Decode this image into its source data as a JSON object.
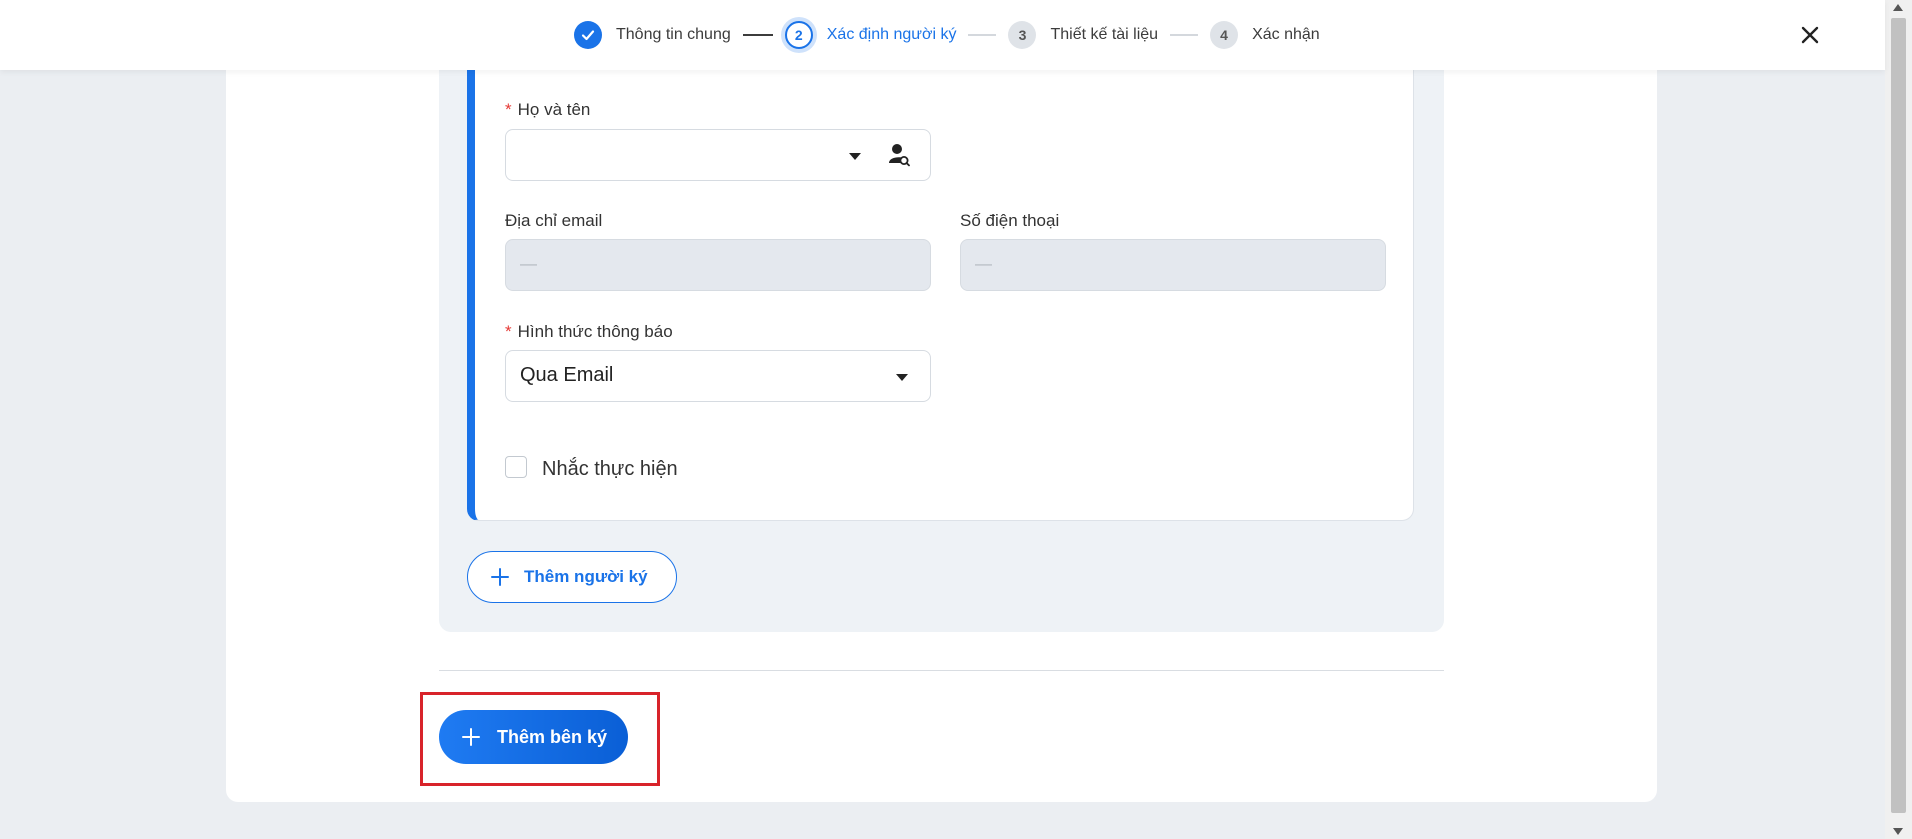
{
  "stepper": {
    "steps": [
      {
        "number": "1",
        "label": "Thông tin chung",
        "state": "done"
      },
      {
        "number": "2",
        "label": "Xác định người ký",
        "state": "active"
      },
      {
        "number": "3",
        "label": "Thiết kế tài liệu",
        "state": "pending"
      },
      {
        "number": "4",
        "label": "Xác nhận",
        "state": "pending"
      }
    ]
  },
  "form": {
    "full_name": {
      "label": "Họ và tên",
      "required_mark": "*",
      "value": ""
    },
    "email": {
      "label": "Địa chỉ email",
      "placeholder": "—"
    },
    "phone": {
      "label": "Số điện thoại",
      "placeholder": "—"
    },
    "notify": {
      "label": "Hình thức thông báo",
      "required_mark": "*",
      "value": "Qua Email"
    },
    "reminder": {
      "label": "Nhắc thực hiện",
      "checked": false
    }
  },
  "actions": {
    "add_signer_person": "Thêm người ký",
    "add_signer_party": "Thêm bên ký"
  },
  "colors": {
    "accent": "#1a73e8",
    "highlight": "#d8232a",
    "required": "#e53935"
  },
  "icons": [
    "check-icon",
    "close-icon",
    "caret-down-icon",
    "user-search-icon",
    "plus-icon"
  ]
}
